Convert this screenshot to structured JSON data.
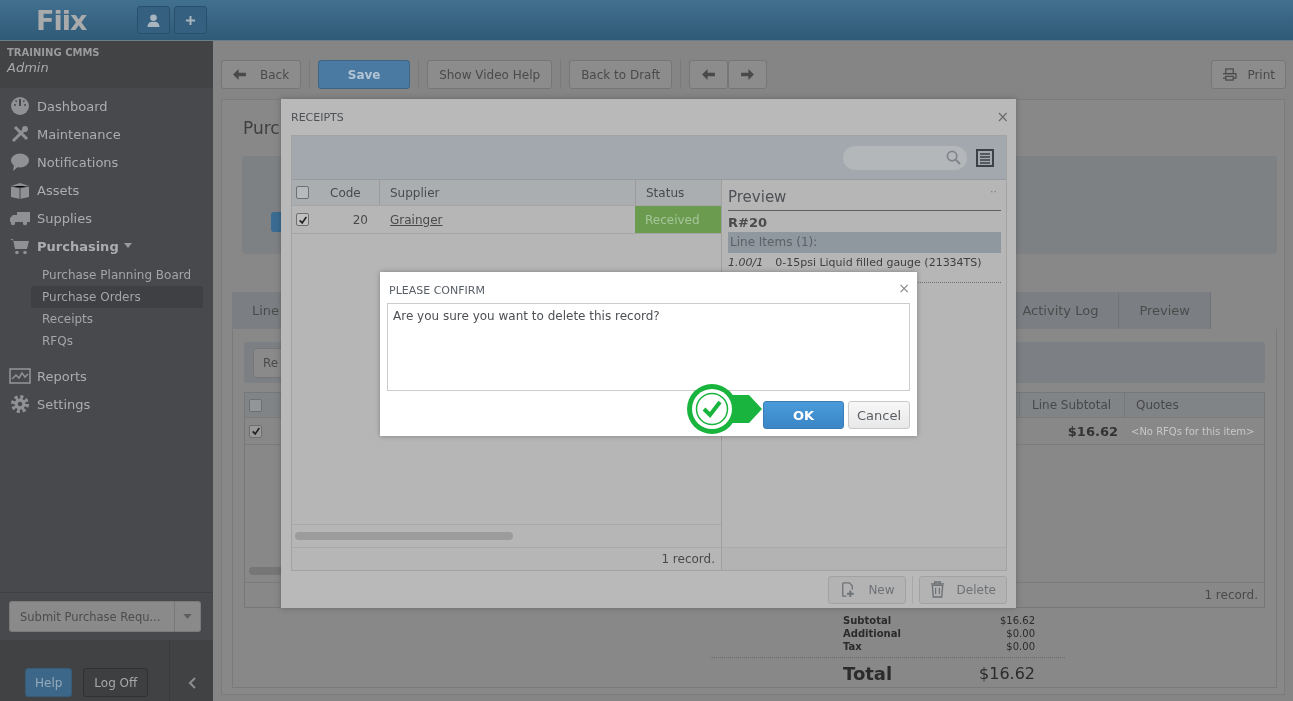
{
  "topbar": {
    "logo": "Fiix"
  },
  "sidebar": {
    "org": "TRAINING CMMS",
    "user": "Admin",
    "items": [
      {
        "label": "Dashboard"
      },
      {
        "label": "Maintenance"
      },
      {
        "label": "Notifications"
      },
      {
        "label": "Assets"
      },
      {
        "label": "Supplies"
      },
      {
        "label": "Purchasing",
        "expanded": true,
        "children": [
          {
            "label": "Purchase Planning Board",
            "selected": false
          },
          {
            "label": "Purchase Orders",
            "selected": true
          },
          {
            "label": "Receipts",
            "selected": false
          },
          {
            "label": "RFQs",
            "selected": false
          }
        ]
      },
      {
        "label": "Reports"
      },
      {
        "label": "Settings"
      }
    ],
    "submit_button": "Submit Purchase Requ...",
    "help_button": "Help",
    "logoff_button": "Log Off"
  },
  "toolbar": {
    "buttons": [
      {
        "kind": "back",
        "label": "Back"
      },
      {
        "kind": "primary",
        "label": "Save"
      },
      {
        "kind": "plain",
        "label": "Show Video Help"
      },
      {
        "kind": "plain",
        "label": "Back to Draft"
      },
      {
        "kind": "prev"
      },
      {
        "kind": "next"
      }
    ],
    "print_button": "Print"
  },
  "page": {
    "title": "Purc",
    "tabs": [
      {
        "label": "Line",
        "selected": false
      },
      {
        "label": "Activity Log",
        "selected": false
      },
      {
        "label": "Preview",
        "selected": false
      }
    ],
    "grid_button": "Re",
    "table": {
      "select_all": false,
      "columns": [
        "Line Subtotal",
        "Quotes"
      ],
      "rows": [
        {
          "checked": true,
          "line_subtotal": "$16.62",
          "quotes": "<No RFQs for this item>"
        }
      ],
      "footer": "1 record."
    },
    "totals": [
      {
        "label": "Subtotal",
        "value": "$16.62"
      },
      {
        "label": "Additional",
        "value": "$0.00"
      },
      {
        "label": "Tax",
        "value": "$0.00"
      }
    ],
    "total": {
      "label": "Total",
      "value": "$16.62"
    }
  },
  "receipts_dialog": {
    "title": "RECEIPTS",
    "close": "×",
    "table": {
      "select_all": false,
      "columns": [
        "Code",
        "Supplier",
        "Status"
      ],
      "rows": [
        {
          "checked": true,
          "code": "20",
          "supplier": "Grainger",
          "status": "Received"
        }
      ],
      "footer": "1 record."
    },
    "preview": {
      "title": "Preview",
      "menu": "··",
      "record": "R#20",
      "section": "Line Items (1):",
      "line": {
        "quantity": "1.00/1",
        "description": "0-15psi Liquid filled gauge (21334TS)"
      }
    },
    "buttons": [
      {
        "kind": "new",
        "label": "New"
      },
      {
        "kind": "delete",
        "label": "Delete"
      }
    ]
  },
  "confirm_dialog": {
    "title": "PLEASE CONFIRM",
    "close": "×",
    "message": "Are you sure you want to delete this record?",
    "buttons": [
      {
        "kind": "primary",
        "label": "OK"
      },
      {
        "kind": "plain",
        "label": "Cancel"
      }
    ]
  }
}
